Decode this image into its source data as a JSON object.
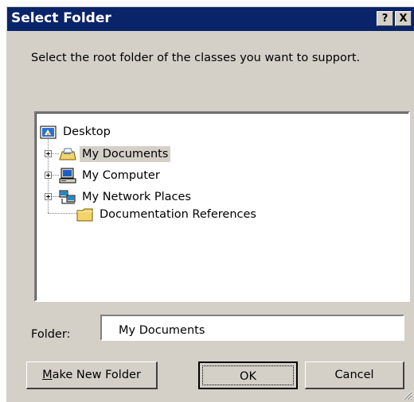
{
  "window": {
    "title": "Select Folder",
    "help_label": "?",
    "close_label": "X"
  },
  "description": "Select the root folder of the classes you want to support.",
  "tree": {
    "root": {
      "label": "Desktop",
      "icon": "desktop-icon"
    },
    "items": [
      {
        "label": "My Documents",
        "icon": "my-documents-icon",
        "expandable": true,
        "selected": true
      },
      {
        "label": "My Computer",
        "icon": "my-computer-icon",
        "expandable": true,
        "selected": false
      },
      {
        "label": "My Network Places",
        "icon": "network-places-icon",
        "expandable": true,
        "selected": false
      },
      {
        "label": "Documentation References",
        "icon": "folder-icon",
        "expandable": false,
        "selected": false
      }
    ]
  },
  "folder": {
    "label": "Folder:",
    "value": "My Documents"
  },
  "buttons": {
    "make_new_folder_accel": "M",
    "make_new_folder_rest": "ake New Folder",
    "ok": "OK",
    "cancel": "Cancel"
  },
  "colors": {
    "titlebar": "#0a246a",
    "face": "#d4d0c8",
    "selection": "#d4d0c8"
  }
}
